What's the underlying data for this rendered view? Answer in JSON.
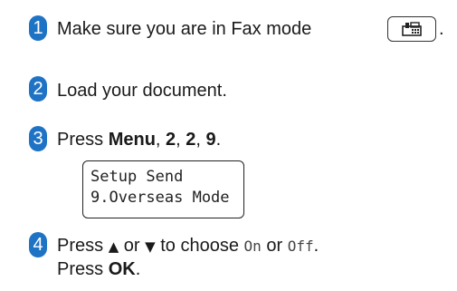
{
  "colors": {
    "accent": "#1f73c4"
  },
  "steps": [
    {
      "number": "1",
      "text": "Make sure you are in Fax mode",
      "trailing": "."
    },
    {
      "number": "2",
      "text": "Load your document."
    },
    {
      "number": "3",
      "prefix": "Press ",
      "menu": "Menu",
      "sep1": ", ",
      "n1": "2",
      "sep2": ", ",
      "n2": "2",
      "sep3": ", ",
      "n3": "9",
      "end": "."
    },
    {
      "number": "4",
      "prefix": "Press ",
      "up": "▲",
      "or1": " or ",
      "down": "▼",
      "mid": " to choose ",
      "on": "On",
      "or2": " or ",
      "off": "Off",
      "end": ".",
      "line2_prefix": "Press ",
      "ok": "OK",
      "line2_end": "."
    }
  ],
  "fax_key": {
    "icon": "fax-icon"
  },
  "lcd": {
    "line1": "Setup Send",
    "line2": "9.Overseas Mode"
  }
}
